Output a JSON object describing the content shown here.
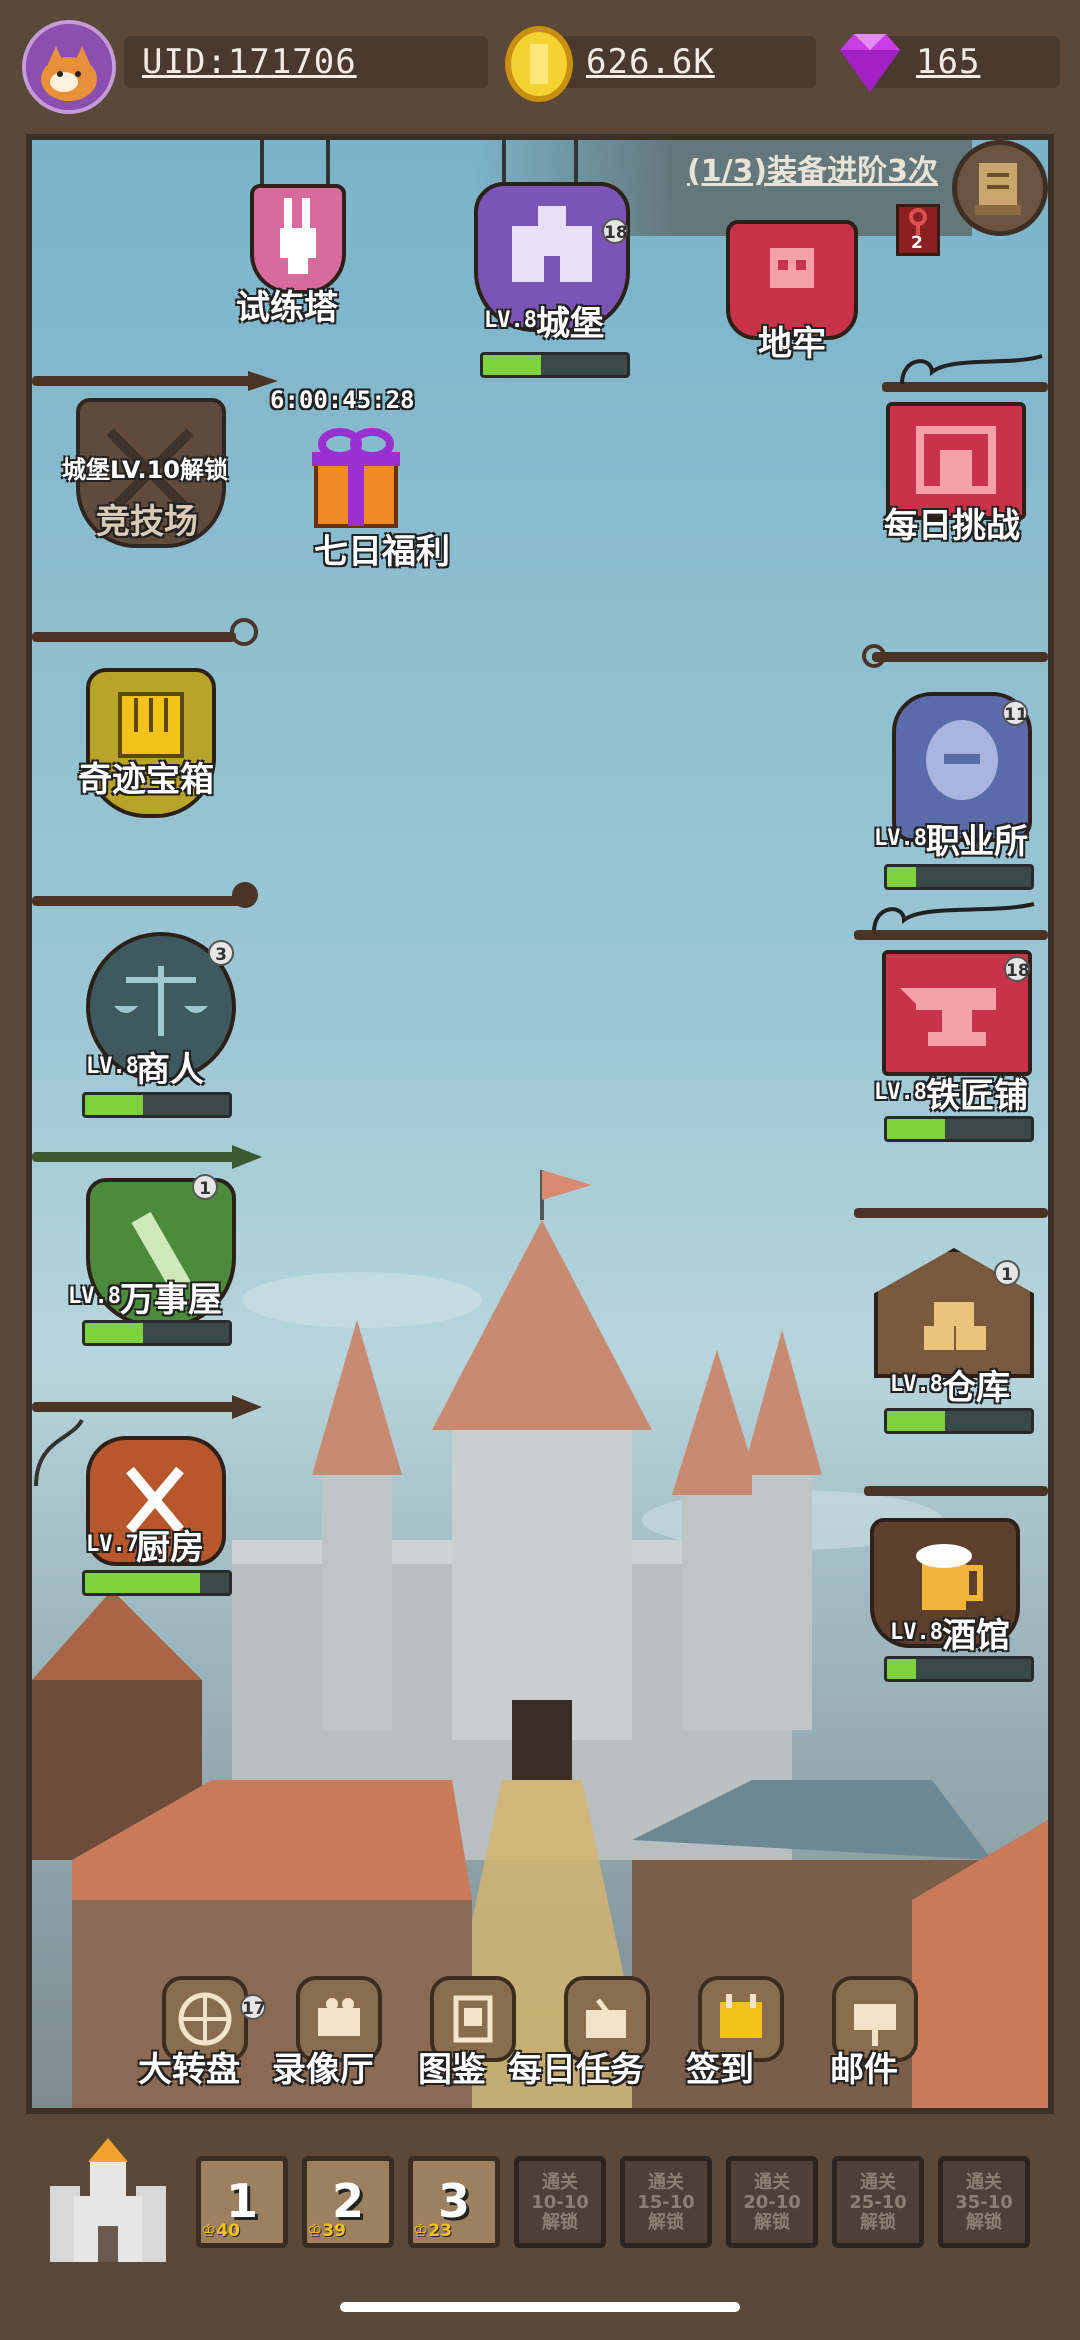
{
  "header": {
    "uid": "UID:171706",
    "gold": "626.6K",
    "gems": "165"
  },
  "quest": {
    "text": "(1/3)装备进阶3次",
    "key_count": "2"
  },
  "buildings": {
    "trial_tower": {
      "label": "试练塔"
    },
    "castle": {
      "label": "城堡",
      "level": "LV.8",
      "badge": "18",
      "progress": 0.4
    },
    "dungeon": {
      "label": "地牢"
    },
    "arena": {
      "label": "竞技场",
      "lock_text": "城堡LV.10解锁"
    },
    "seven_day": {
      "label": "七日福利",
      "timer": "6:00:45:28"
    },
    "daily_challenge": {
      "label": "每日挑战"
    },
    "wonder_chest": {
      "label": "奇迹宝箱"
    },
    "job_center": {
      "label": "职业所",
      "level": "LV.8",
      "badge": "11",
      "progress": 0.2
    },
    "merchant": {
      "label": "商人",
      "level": "LV.8",
      "badge": "3",
      "progress": 0.4
    },
    "blacksmith": {
      "label": "铁匠铺",
      "level": "LV.8",
      "badge": "18",
      "progress": 0.4
    },
    "general_store": {
      "label": "万事屋",
      "level": "LV.8",
      "badge": "1",
      "progress": 0.4
    },
    "warehouse": {
      "label": "仓库",
      "level": "LV.8",
      "badge": "1",
      "progress": 0.4
    },
    "kitchen": {
      "label": "厨房",
      "level": "LV.7",
      "progress": 0.8
    },
    "tavern": {
      "label": "酒馆",
      "level": "LV.8",
      "progress": 0.2
    }
  },
  "bottom_menu": [
    {
      "label": "大转盘",
      "badge": "17"
    },
    {
      "label": "录像厅"
    },
    {
      "label": "图鉴"
    },
    {
      "label": "每日任务"
    },
    {
      "label": "签到"
    },
    {
      "label": "邮件"
    }
  ],
  "slots": [
    {
      "num": "1",
      "count": "40"
    },
    {
      "num": "2",
      "count": "39"
    },
    {
      "num": "3",
      "count": "23"
    }
  ],
  "locked_slots": [
    {
      "line1": "通关",
      "line2": "10-10",
      "line3": "解锁"
    },
    {
      "line1": "通关",
      "line2": "15-10",
      "line3": "解锁"
    },
    {
      "line1": "通关",
      "line2": "20-10",
      "line3": "解锁"
    },
    {
      "line1": "通关",
      "line2": "25-10",
      "line3": "解锁"
    },
    {
      "line1": "通关",
      "line2": "35-10",
      "line3": "解锁"
    }
  ],
  "colors": {
    "progress": "#7fd23c",
    "gem": "#c040e0",
    "gold": "#f2c21b"
  }
}
